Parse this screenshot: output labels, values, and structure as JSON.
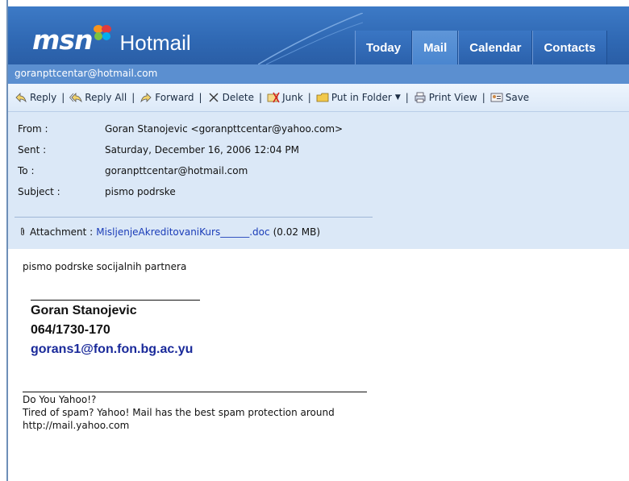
{
  "header": {
    "brand_msn": "msn",
    "brand_product": "Hotmail",
    "tabs": [
      {
        "label": "Today",
        "active": false
      },
      {
        "label": "Mail",
        "active": true
      },
      {
        "label": "Calendar",
        "active": false
      },
      {
        "label": "Contacts",
        "active": false
      }
    ]
  },
  "account": {
    "email": "goranpttcentar@hotmail.com"
  },
  "toolbar": {
    "reply": "Reply",
    "reply_all": "Reply All",
    "forward": "Forward",
    "delete": "Delete",
    "junk": "Junk",
    "put_in_folder": "Put in Folder",
    "print_view": "Print View",
    "save": "Save"
  },
  "message": {
    "from_label": "From :",
    "from_value": "Goran Stanojevic <goranpttcentar@yahoo.com>",
    "sent_label": "Sent :",
    "sent_value": "Saturday, December 16, 2006 12:04 PM",
    "to_label": "To :",
    "to_value": "goranpttcentar@hotmail.com",
    "subject_label": "Subject :",
    "subject_value": "pismo podrske",
    "attachment_label": "Attachment :",
    "attachment_name": "MisljenjeAkreditovaniKurs______.doc",
    "attachment_size": "(0.02 MB)"
  },
  "body": {
    "text": "pismo podrske socijalnih partnera",
    "signature_name": "Goran Stanojevic",
    "signature_phone": "064/1730-170",
    "signature_email": "gorans1@fon.fon.bg.ac.yu",
    "footer_line1": "Do You Yahoo!?",
    "footer_line2": "Tired of spam? Yahoo! Mail has the best spam protection around",
    "footer_line3": "http://mail.yahoo.com"
  },
  "colors": {
    "header_blue": "#2f68b3",
    "account_bar": "#5b8fd0",
    "headers_bg": "#dbe8f7",
    "link_blue": "#1a3cb8"
  }
}
